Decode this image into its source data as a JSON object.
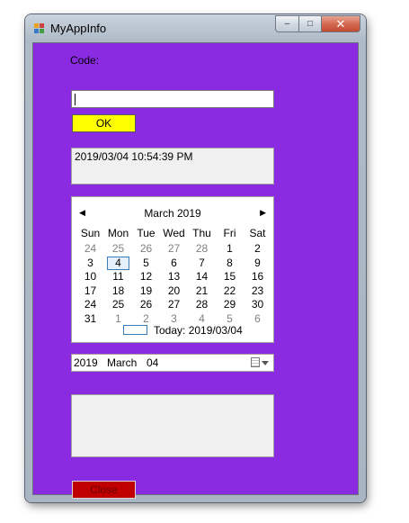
{
  "window": {
    "title": "MyAppInfo",
    "icon": "app-window-icon",
    "controls": {
      "minimize": "–",
      "maximize": "□",
      "close": "✕"
    },
    "client_color": "#8a2be2"
  },
  "form": {
    "code_label": "Code:",
    "code_value": "",
    "ok_label": "OK",
    "ok_color": "#ffff00",
    "output_text": "2019/03/04 10:54:39 PM",
    "close_label": "Close",
    "close_color": "#c00000"
  },
  "calendar": {
    "month_title": "March 2019",
    "days_of_week": [
      "Sun",
      "Mon",
      "Tue",
      "Wed",
      "Thu",
      "Fri",
      "Sat"
    ],
    "weeks": [
      [
        "24",
        "25",
        "26",
        "27",
        "28",
        "1",
        "2"
      ],
      [
        "3",
        "4",
        "5",
        "6",
        "7",
        "8",
        "9"
      ],
      [
        "10",
        "11",
        "12",
        "13",
        "14",
        "15",
        "16"
      ],
      [
        "17",
        "18",
        "19",
        "20",
        "21",
        "22",
        "23"
      ],
      [
        "24",
        "25",
        "26",
        "27",
        "28",
        "29",
        "30"
      ],
      [
        "31",
        "1",
        "2",
        "3",
        "4",
        "5",
        "6"
      ]
    ],
    "selected_day": "4",
    "today_text": "Today: 2019/03/04"
  },
  "date_picker": {
    "year": "2019",
    "month": "March",
    "day": "04"
  }
}
